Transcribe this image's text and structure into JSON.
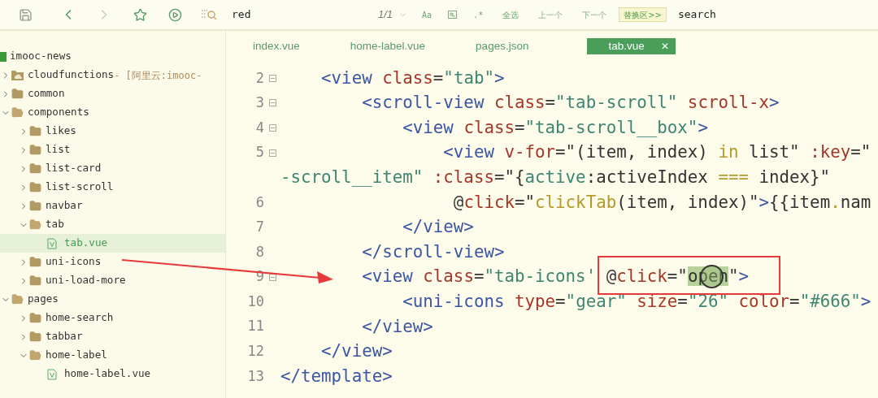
{
  "toolbar": {
    "find": {
      "value": "red",
      "count": "1/1"
    },
    "options": [
      {
        "kind": "text",
        "label": "Aa"
      },
      {
        "kind": "icon"
      },
      {
        "kind": "text",
        "label": ".*"
      }
    ],
    "actions": [
      "全选",
      "上一个",
      "下一个"
    ],
    "replace_toggle": "替换区>>",
    "replace": {
      "value": "search"
    },
    "forward_disabled": true
  },
  "sidebar": {
    "items": [
      {
        "kind": "project",
        "label": "imooc-news",
        "selected": false,
        "children": [
          {
            "kind": "cloud",
            "label": "cloudfunctions",
            "suffix": " - [阿里云:imooc-",
            "expanded": false,
            "selected": false
          },
          {
            "kind": "folder",
            "label": "common",
            "expanded": false,
            "selected": false
          },
          {
            "kind": "folder",
            "label": "components",
            "expanded": true,
            "selected": false,
            "children": [
              {
                "kind": "folder",
                "label": "likes",
                "expanded": false,
                "selected": false
              },
              {
                "kind": "folder",
                "label": "list",
                "expanded": false,
                "selected": false
              },
              {
                "kind": "folder",
                "label": "list-card",
                "expanded": false,
                "selected": false
              },
              {
                "kind": "folder",
                "label": "list-scroll",
                "expanded": false,
                "selected": false
              },
              {
                "kind": "folder",
                "label": "navbar",
                "expanded": false,
                "selected": false
              },
              {
                "kind": "folder",
                "label": "tab",
                "expanded": true,
                "selected": false,
                "children": [
                  {
                    "kind": "file",
                    "label": "tab.vue",
                    "selected": true
                  }
                ]
              },
              {
                "kind": "folder",
                "label": "uni-icons",
                "expanded": false,
                "selected": false
              },
              {
                "kind": "folder",
                "label": "uni-load-more",
                "expanded": false,
                "selected": false
              }
            ]
          },
          {
            "kind": "folder",
            "label": "pages",
            "expanded": true,
            "selected": false,
            "children": [
              {
                "kind": "folder",
                "label": "home-search",
                "expanded": false,
                "selected": false
              },
              {
                "kind": "folder",
                "label": "tabbar",
                "expanded": false,
                "selected": false
              },
              {
                "kind": "folder",
                "label": "home-label",
                "expanded": true,
                "selected": false,
                "children": [
                  {
                    "kind": "file",
                    "label": "home-label.vue",
                    "selected": false
                  }
                ]
              }
            ]
          }
        ]
      }
    ]
  },
  "tabs": [
    {
      "label": "index.vue",
      "selected": false
    },
    {
      "label": "home-label.vue",
      "selected": false
    },
    {
      "label": "pages.json",
      "selected": false
    },
    {
      "label": "tab.vue",
      "selected": true,
      "close": "✕"
    }
  ],
  "editor": {
    "lines": [
      {
        "number": "2",
        "foldable": true,
        "tokens": [
          {
            "kind": "tag",
            "text": "    <view "
          },
          {
            "kind": "attr",
            "text": "class"
          },
          {
            "kind": "plain",
            "text": "="
          },
          {
            "kind": "str",
            "text": "\"tab\""
          },
          {
            "kind": "tag",
            "text": ">"
          }
        ]
      },
      {
        "number": "3",
        "foldable": true,
        "tokens": [
          {
            "kind": "tag",
            "text": "        <scroll-view "
          },
          {
            "kind": "attr",
            "text": "class"
          },
          {
            "kind": "plain",
            "text": "="
          },
          {
            "kind": "str",
            "text": "\"tab-scroll\" "
          },
          {
            "kind": "attr",
            "text": "scroll-x"
          },
          {
            "kind": "tag",
            "text": ">"
          }
        ]
      },
      {
        "number": "4",
        "foldable": true,
        "tokens": [
          {
            "kind": "tag",
            "text": "            <view "
          },
          {
            "kind": "attr",
            "text": "class"
          },
          {
            "kind": "plain",
            "text": "="
          },
          {
            "kind": "str",
            "text": "\"tab-scroll__box\""
          },
          {
            "kind": "tag",
            "text": ">"
          }
        ]
      },
      {
        "number": "5",
        "foldable": true,
        "tokens": [
          {
            "kind": "tag",
            "text": "                <view "
          },
          {
            "kind": "attr",
            "text": "v-for"
          },
          {
            "kind": "plain",
            "text": "=\"(item, index) "
          },
          {
            "kind": "kw",
            "text": "in"
          },
          {
            "kind": "plain",
            "text": " list\" "
          },
          {
            "kind": "attr",
            "text": ":key"
          },
          {
            "kind": "plain",
            "text": "=\""
          }
        ]
      },
      {
        "foldable": false,
        "tokens": [
          {
            "kind": "str",
            "text": "-scroll__item\" "
          },
          {
            "kind": "attr",
            "text": ":class"
          },
          {
            "kind": "plain",
            "text": "=\"{"
          },
          {
            "kind": "str",
            "text": "active"
          },
          {
            "kind": "plain",
            "text": ":activeIndex "
          },
          {
            "kind": "kw",
            "text": "==="
          },
          {
            "kind": "plain",
            "text": " index}\""
          }
        ]
      },
      {
        "number": "6",
        "foldable": false,
        "tokens": [
          {
            "kind": "plain",
            "text": "                 @"
          },
          {
            "kind": "attr",
            "text": "click"
          },
          {
            "kind": "plain",
            "text": "=\""
          },
          {
            "kind": "kw",
            "text": "clickTab"
          },
          {
            "kind": "plain",
            "text": "(item, index)\""
          },
          {
            "kind": "tag",
            "text": ">"
          },
          {
            "kind": "plain",
            "text": "{{item"
          },
          {
            "kind": "kw",
            "text": "."
          },
          {
            "kind": "plain",
            "text": "nam"
          }
        ]
      },
      {
        "number": "7",
        "foldable": false,
        "tokens": [
          {
            "kind": "tag",
            "text": "            </view>"
          }
        ]
      },
      {
        "number": "8",
        "foldable": false,
        "tokens": [
          {
            "kind": "tag",
            "text": "        </scroll-view>"
          }
        ]
      },
      {
        "number": "9",
        "foldable": true,
        "tokens": [
          {
            "kind": "tag",
            "text": "        <view "
          },
          {
            "kind": "attr",
            "text": "class"
          },
          {
            "kind": "plain",
            "text": "="
          },
          {
            "kind": "str",
            "text": "\"tab-icons' "
          },
          {
            "kind": "plain",
            "text": "@"
          },
          {
            "kind": "attr",
            "text": "click"
          },
          {
            "kind": "plain",
            "text": "=\""
          },
          {
            "kind": "match",
            "text": "open"
          },
          {
            "kind": "plain",
            "text": "\""
          },
          {
            "kind": "tag",
            "text": ">"
          }
        ]
      },
      {
        "number": "10",
        "foldable": false,
        "tokens": [
          {
            "kind": "tag",
            "text": "            <uni-icons "
          },
          {
            "kind": "attr",
            "text": "type"
          },
          {
            "kind": "plain",
            "text": "="
          },
          {
            "kind": "str",
            "text": "\"gear\" "
          },
          {
            "kind": "attr",
            "text": "size"
          },
          {
            "kind": "plain",
            "text": "="
          },
          {
            "kind": "str",
            "text": "\"26\" "
          },
          {
            "kind": "attr",
            "text": "color"
          },
          {
            "kind": "plain",
            "text": "="
          },
          {
            "kind": "str",
            "text": "\"#666\""
          },
          {
            "kind": "tag",
            "text": ">"
          }
        ]
      },
      {
        "number": "11",
        "foldable": false,
        "tokens": [
          {
            "kind": "tag",
            "text": "        </view>"
          }
        ]
      },
      {
        "number": "12",
        "foldable": false,
        "tokens": [
          {
            "kind": "tag",
            "text": "    </view>"
          }
        ]
      },
      {
        "number": "13",
        "foldable": false,
        "tokens": [
          {
            "kind": "tag",
            "text": "</template>"
          }
        ]
      }
    ]
  }
}
